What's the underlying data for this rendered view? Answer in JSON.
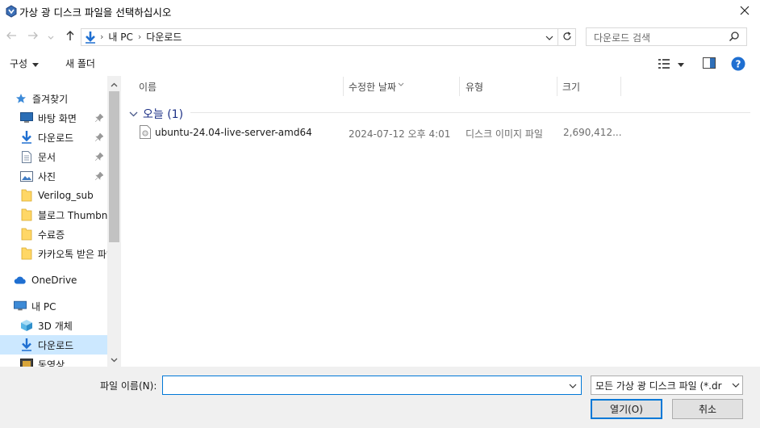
{
  "window": {
    "title": "가상 광 디스크 파일을 선택하십시오",
    "icon": "virtualbox-icon",
    "close_icon": "close-icon"
  },
  "address": {
    "path": [
      "내 PC",
      "다운로드"
    ],
    "search_placeholder": "다운로드 검색"
  },
  "toolbar": {
    "organize_label": "구성",
    "new_folder_label": "새 폴더"
  },
  "nav": {
    "items": [
      {
        "label": "즐겨찾기",
        "icon": "star-icon",
        "pinned": false
      },
      {
        "label": "바탕 화면",
        "icon": "desktop-icon",
        "pinned": true
      },
      {
        "label": "다운로드",
        "icon": "download-arrow-icon",
        "pinned": true
      },
      {
        "label": "문서",
        "icon": "document-icon",
        "pinned": true
      },
      {
        "label": "사진",
        "icon": "picture-icon",
        "pinned": true
      },
      {
        "label": "Verilog_sub",
        "icon": "folder-icon",
        "pinned": false
      },
      {
        "label": "블로그 Thumbnail",
        "icon": "folder-icon",
        "pinned": false
      },
      {
        "label": "수료증",
        "icon": "folder-icon",
        "pinned": false
      },
      {
        "label": "카카오톡 받은 파일",
        "icon": "folder-icon",
        "pinned": false
      },
      {
        "label": "OneDrive",
        "icon": "cloud-icon",
        "pinned": false
      },
      {
        "label": "내 PC",
        "icon": "pc-icon",
        "pinned": false
      },
      {
        "label": "3D 개체",
        "icon": "cube-icon",
        "pinned": false
      },
      {
        "label": "다운로드",
        "icon": "download-arrow-icon",
        "pinned": false,
        "selected": true
      },
      {
        "label": "동영상",
        "icon": "video-icon",
        "pinned": false
      }
    ]
  },
  "columns": {
    "name": "이름",
    "modified": "수정한 날짜",
    "type": "유형",
    "size": "크기"
  },
  "group": {
    "label": "오늘 (1)"
  },
  "files": [
    {
      "name": "ubuntu-24.04-live-server-amd64",
      "modified": "2024-07-12 오후 4:01",
      "type": "디스크 이미지 파일",
      "size": "2,690,412..."
    }
  ],
  "bottom": {
    "filename_label": "파일 이름(N):",
    "filename_value": "",
    "filter_value": "모든 가상 광 디스크 파일 (*.dr",
    "open_label": "열기(O)",
    "cancel_label": "취소"
  },
  "colors": {
    "accent": "#0078d7",
    "selection": "#cce8ff",
    "group_header": "#1e3287"
  }
}
